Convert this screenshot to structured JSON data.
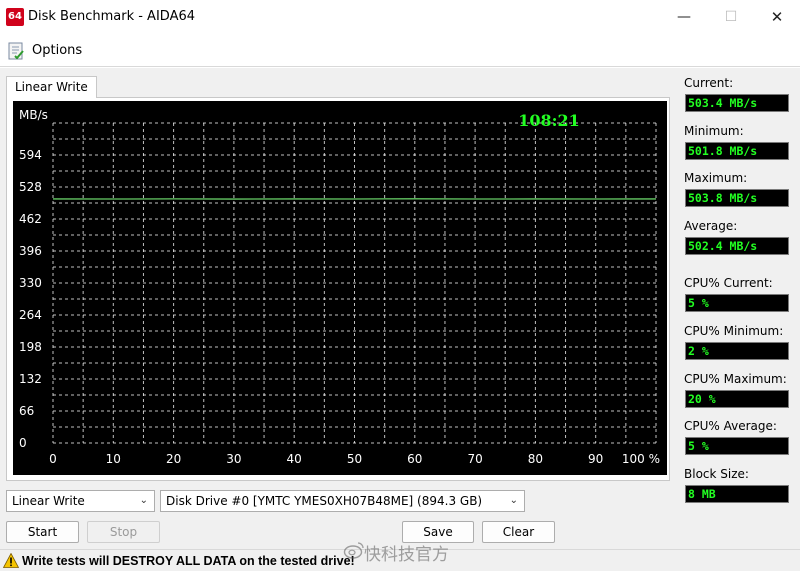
{
  "window": {
    "app_icon_text": "64",
    "title": "Disk Benchmark - AIDA64",
    "minimize_glyph": "—",
    "maximize_glyph": "☐",
    "close_glyph": "✕"
  },
  "menu": {
    "options_label": "Options",
    "options_icon": "options-checklist-icon"
  },
  "tab": {
    "label": "Linear Write"
  },
  "chart_data": {
    "type": "line",
    "ylabel": "MB/s",
    "xlabel": "",
    "timer": "108:21",
    "y_ticks": [
      "594",
      "528",
      "462",
      "396",
      "330",
      "264",
      "198",
      "132",
      "66",
      "0"
    ],
    "x_ticks": [
      "0",
      "10",
      "20",
      "30",
      "40",
      "50",
      "60",
      "70",
      "80",
      "90",
      "100 %"
    ],
    "ylim": [
      0,
      660
    ],
    "xlim": [
      0,
      100
    ],
    "grid": true,
    "series": [
      {
        "x": [
          0,
          10,
          20,
          30,
          40,
          50,
          60,
          70,
          80,
          90,
          100
        ],
        "y": [
          503.4,
          503.2,
          503.5,
          503.1,
          503.4,
          503.3,
          503.6,
          503.2,
          503.4,
          503.3,
          503.4
        ]
      }
    ],
    "colors": {
      "background": "#000000",
      "grid": "#ffffff",
      "line": "#66cc66",
      "text": "#ffffff",
      "timer": "#22ff22"
    }
  },
  "stats": {
    "current_label": "Current:",
    "current_value": "503.4 MB/s",
    "minimum_label": "Minimum:",
    "minimum_value": "501.8 MB/s",
    "maximum_label": "Maximum:",
    "maximum_value": "503.8 MB/s",
    "average_label": "Average:",
    "average_value": "502.4 MB/s",
    "cpu_current_label": "CPU% Current:",
    "cpu_current_value": "5 %",
    "cpu_minimum_label": "CPU% Minimum:",
    "cpu_minimum_value": "2 %",
    "cpu_maximum_label": "CPU% Maximum:",
    "cpu_maximum_value": "20 %",
    "cpu_average_label": "CPU% Average:",
    "cpu_average_value": "5 %",
    "block_size_label": "Block Size:",
    "block_size_value": "8 MB"
  },
  "controls": {
    "test_select_value": "Linear Write",
    "drive_select_value": "Disk Drive #0  [YMTC YMES0XH07B48ME]  (894.3 GB)",
    "start_label": "Start",
    "stop_label": "Stop",
    "save_label": "Save",
    "clear_label": "Clear"
  },
  "status": {
    "warning_text": "Write tests will DESTROY ALL DATA on the tested drive!",
    "watermark": "快科技官方"
  }
}
